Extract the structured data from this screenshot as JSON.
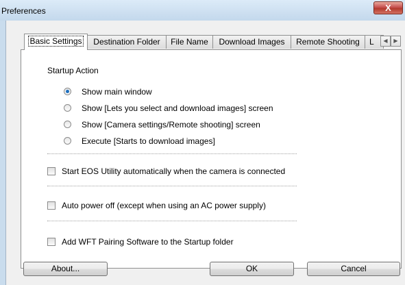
{
  "window": {
    "title": "Preferences",
    "close_symbol": "X"
  },
  "tabs": [
    {
      "label": "Basic Settings"
    },
    {
      "label": "Destination Folder"
    },
    {
      "label": "File Name"
    },
    {
      "label": "Download Images"
    },
    {
      "label": "Remote Shooting"
    },
    {
      "label": "L"
    }
  ],
  "tab_scroll": {
    "left": "◀",
    "right": "▶"
  },
  "startup": {
    "heading": "Startup Action",
    "selected_option": "Show main window",
    "options": [
      {
        "label": "Show main window",
        "checked": true
      },
      {
        "label": "Show [Lets you select and download images] screen",
        "checked": false
      },
      {
        "label": "Show [Camera settings/Remote shooting] screen",
        "checked": false
      },
      {
        "label": "Execute [Starts to download images]",
        "checked": false
      }
    ]
  },
  "checkboxes": [
    {
      "label": "Start EOS Utility automatically when the camera is connected",
      "checked": false
    },
    {
      "label": "Auto power off (except when using an AC power supply)",
      "checked": false
    },
    {
      "label": "Add WFT Pairing Software to the Startup folder",
      "checked": false
    }
  ],
  "buttons": {
    "about": "About...",
    "ok": "OK",
    "cancel": "Cancel"
  }
}
